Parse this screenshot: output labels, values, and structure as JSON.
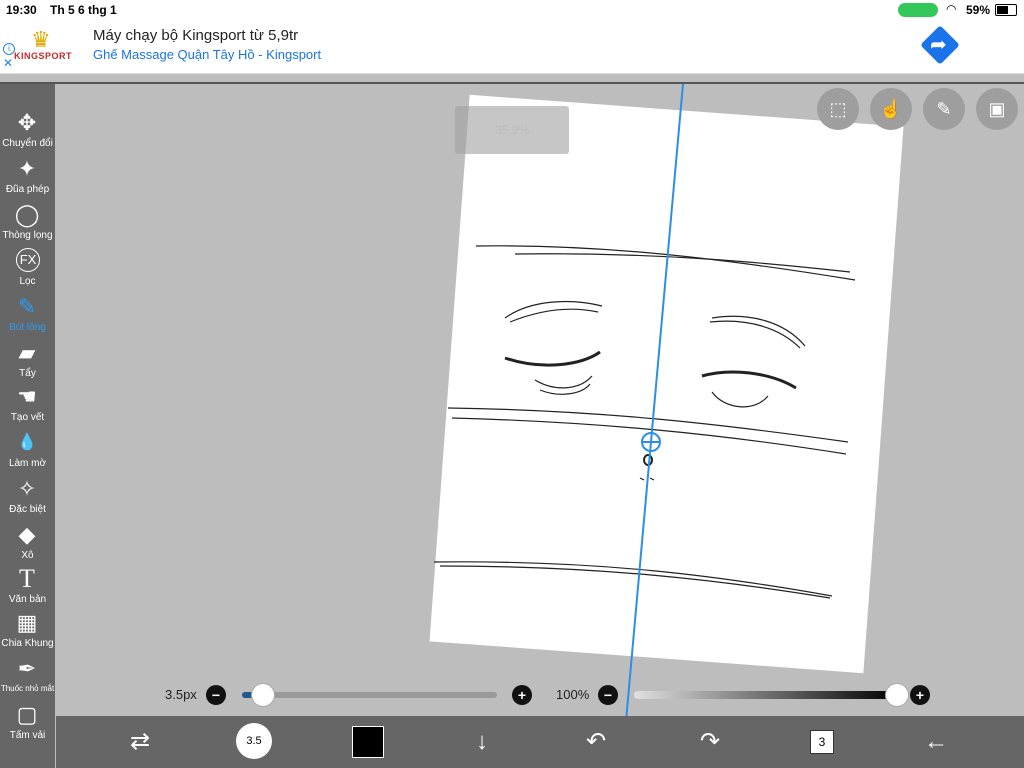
{
  "status_bar": {
    "time": "19:30",
    "date": "Th 5 6 thg 1",
    "battery": "59%"
  },
  "ad": {
    "headline": "Máy chạy bộ Kingsport từ 5,9tr",
    "subline": "Ghế Massage Quận Tây Hồ - Kingsport",
    "brand": "KINGSPORT",
    "info_icon": "info-icon",
    "close_icon": "close-icon"
  },
  "tools": [
    {
      "label": "Chuyển đổi",
      "icon": "✥"
    },
    {
      "label": "Đũa phép",
      "icon": "✦"
    },
    {
      "label": "Thòng lọng",
      "icon": "◯"
    },
    {
      "label": "Lọc",
      "icon": "FX"
    },
    {
      "label": "Bút lông",
      "icon": "✎",
      "active": true
    },
    {
      "label": "Tẩy",
      "icon": "▰"
    },
    {
      "label": "Tạo vết",
      "icon": "☚"
    },
    {
      "label": "Làm mờ",
      "icon": "💧"
    },
    {
      "label": "Đặc biệt",
      "icon": "✧"
    },
    {
      "label": "Xô",
      "icon": "◆"
    },
    {
      "label": "Văn bản",
      "icon": "T"
    },
    {
      "label": "Chia Khung",
      "icon": "▦"
    },
    {
      "label": "Thuốc nhỏ mắt",
      "icon": "✒"
    },
    {
      "label": "Tấm vải",
      "icon": "▢"
    }
  ],
  "canvas": {
    "zoom": "35.9%"
  },
  "brush": {
    "size_label": "3.5px",
    "size_fraction": 0.08
  },
  "opacity": {
    "label": "100%",
    "value_fraction": 1.0
  },
  "toolbar": {
    "brush_size_indicator": "3.5",
    "layers_count": "3"
  },
  "colors": {
    "accent": "#2b9bf2",
    "primary": "#000000"
  }
}
